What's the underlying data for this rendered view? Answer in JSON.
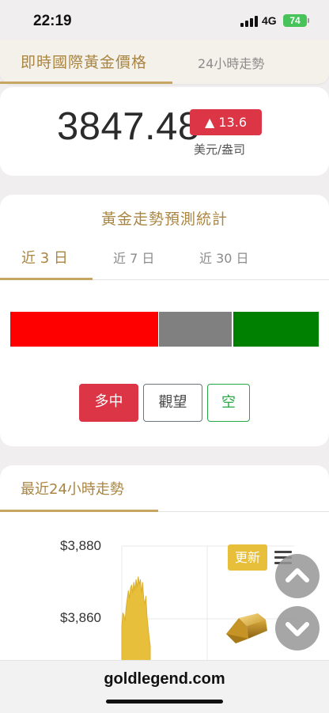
{
  "status": {
    "time": "22:19",
    "network": "4G",
    "battery": "74"
  },
  "header_tabs": {
    "live_price": "即時國際黃金價格",
    "trend_24h": "24小時走勢"
  },
  "price": {
    "value": "3847.48",
    "change": "▲ 13.6",
    "unit": "美元/盎司",
    "change_color": "#dc3545"
  },
  "forecast": {
    "title": "黃金走勢預測統計",
    "tabs": [
      "近 3 日",
      "近 7 日",
      "近 30 日"
    ],
    "active_tab": 0,
    "bar_colors": {
      "bull": "#ff0000",
      "neutral": "#808080",
      "bear": "#008000"
    },
    "buttons": {
      "bull": "多中",
      "neutral": "觀望",
      "bear": "空"
    }
  },
  "trend": {
    "title": "最近24小時走勢",
    "update_label": "更新",
    "chart_data": {
      "type": "area",
      "yticks": [
        "$3,880",
        "$3,860"
      ],
      "ylim": [
        3840,
        3885
      ],
      "color": "#e8bf3a",
      "values": [
        3856,
        3861,
        3860,
        3858,
        3863,
        3866,
        3869,
        3866,
        3870,
        3871,
        3868,
        3872,
        3869,
        3873,
        3870,
        3874,
        3871,
        3873,
        3868,
        3872,
        3866,
        3864,
        3867,
        3860,
        3856,
        3852,
        3849
      ]
    }
  },
  "footer": {
    "url": "goldlegend.com"
  }
}
